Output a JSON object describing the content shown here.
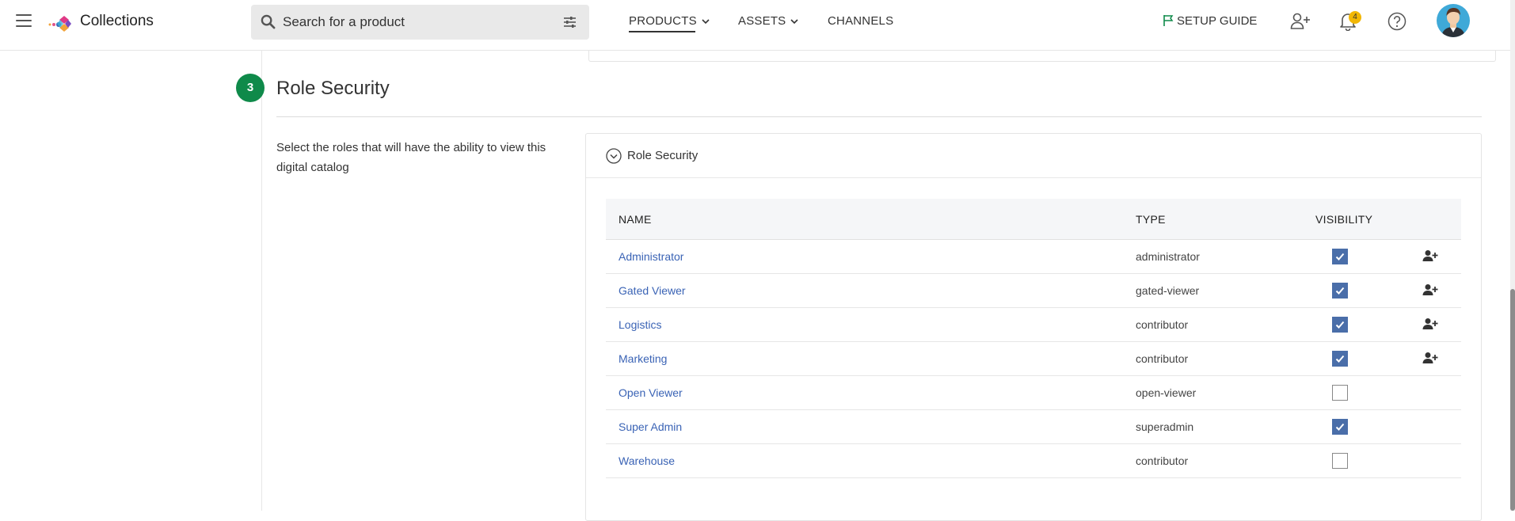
{
  "app": {
    "title": "Collections"
  },
  "search": {
    "placeholder": "Search for a product"
  },
  "nav": {
    "products": "PRODUCTS",
    "assets": "ASSETS",
    "channels": "CHANNELS"
  },
  "header": {
    "setup_guide": "SETUP GUIDE",
    "notifications_count": "4"
  },
  "icons": {
    "menu": "hamburger-icon",
    "logo": "collections-logo",
    "search": "search-icon",
    "filter": "filter-sliders-icon",
    "flag": "flag-icon",
    "add_user": "add-user-icon",
    "bell": "bell-icon",
    "help": "help-icon",
    "avatar": "user-avatar",
    "collapse": "chevron-circle-icon",
    "checkbox": "checkmark-icon"
  },
  "colors": {
    "accent": "#0f8a4a",
    "link": "#3a63b5",
    "checkbox": "#4a6ea9",
    "badge": "#f2b705"
  },
  "section": {
    "step": "3",
    "title": "Role Security",
    "description": "Select the roles that will have the ability to view this digital catalog",
    "card_title": "Role Security"
  },
  "table": {
    "headers": {
      "name": "NAME",
      "type": "TYPE",
      "visibility": "VISIBILITY"
    },
    "rows": [
      {
        "name": "Administrator",
        "type": "administrator",
        "visible": true,
        "can_add_users": true
      },
      {
        "name": "Gated Viewer",
        "type": "gated-viewer",
        "visible": true,
        "can_add_users": true
      },
      {
        "name": "Logistics",
        "type": "contributor",
        "visible": true,
        "can_add_users": true
      },
      {
        "name": "Marketing",
        "type": "contributor",
        "visible": true,
        "can_add_users": true
      },
      {
        "name": "Open Viewer",
        "type": "open-viewer",
        "visible": false,
        "can_add_users": false
      },
      {
        "name": "Super Admin",
        "type": "superadmin",
        "visible": true,
        "can_add_users": false
      },
      {
        "name": "Warehouse",
        "type": "contributor",
        "visible": false,
        "can_add_users": false
      }
    ]
  }
}
